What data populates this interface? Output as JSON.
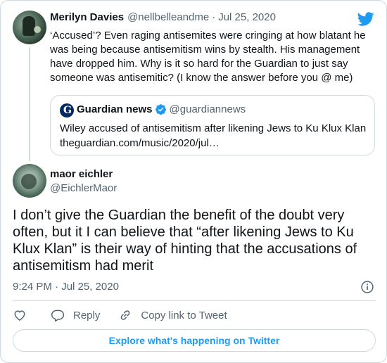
{
  "parent_tweet": {
    "display_name": "Merilyn Davies",
    "handle": "@nellbelleandme",
    "separator": "·",
    "date": "Jul 25, 2020",
    "text": "‘Accused’? Even raging antisemites were cringing at how blatant he was being because antisemitism wins by stealth. His management have dropped him. Why is it so hard for the Guardian to just say someone was antisemitic? (I know the answer before you @ me)"
  },
  "quoted_tweet": {
    "display_name": "Guardian news",
    "handle": "@guardiannews",
    "text": "Wiley accused of antisemitism after likening Jews to Ku Klux Klan",
    "link": "theguardian.com/music/2020/jul…"
  },
  "main_tweet": {
    "display_name": "maor eichler",
    "handle": "@EichlerMaor",
    "text": "I don’t give the Guardian the benefit of the doubt very often, but it I can believe that “after likening Jews to Ku Klux Klan” is their way of hinting that the accusations of antisemitism had merit",
    "timestamp": "9:24 PM · Jul 25, 2020"
  },
  "actions": {
    "reply_label": "Reply",
    "copy_label": "Copy link to Tweet"
  },
  "explore_label": "Explore what's happening on Twitter",
  "colors": {
    "accent": "#1d9bf0",
    "text": "#0f1419",
    "secondary": "#536471",
    "border": "#cfd9de",
    "guardian": "#052962"
  },
  "icons": [
    "twitter-bird-icon",
    "verified-badge-icon",
    "info-icon",
    "heart-icon",
    "reply-icon",
    "copy-link-icon"
  ]
}
